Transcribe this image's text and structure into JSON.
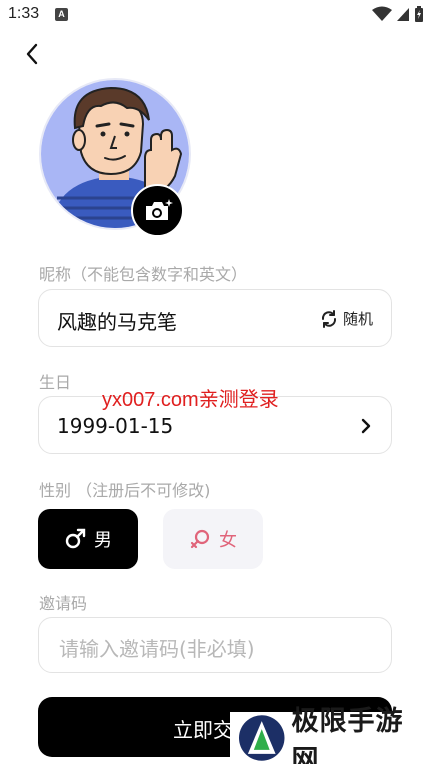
{
  "status_bar": {
    "time": "1:33",
    "notification_badge": "A"
  },
  "nickname": {
    "label": "昵称（不能包含数字和英文）",
    "value": "风趣的马克笔",
    "random_label": "随机"
  },
  "birthday": {
    "label": "生日",
    "value": "1999-01-15"
  },
  "gender": {
    "label": "性别 （注册后不可修改)",
    "male_label": "男",
    "female_label": "女",
    "selected": "male"
  },
  "invite": {
    "label": "邀请码",
    "placeholder": "请输入邀请码(非必填)"
  },
  "submit": {
    "label": "立即交"
  },
  "watermark": {
    "text": "yx007.com亲测登录"
  },
  "logo_overlay": {
    "text": "极限手游网"
  },
  "colors": {
    "primary": "#000000",
    "label_grey": "#a9a9a9",
    "female_accent": "#e0647a",
    "watermark_red": "#e02020",
    "avatar_bg": "#a9b6f5"
  },
  "icons": [
    "back-arrow-icon",
    "camera-icon",
    "refresh-icon",
    "chevron-right-icon",
    "male-symbol-icon",
    "female-symbol-icon",
    "wifi-icon",
    "signal-icon",
    "battery-icon"
  ]
}
